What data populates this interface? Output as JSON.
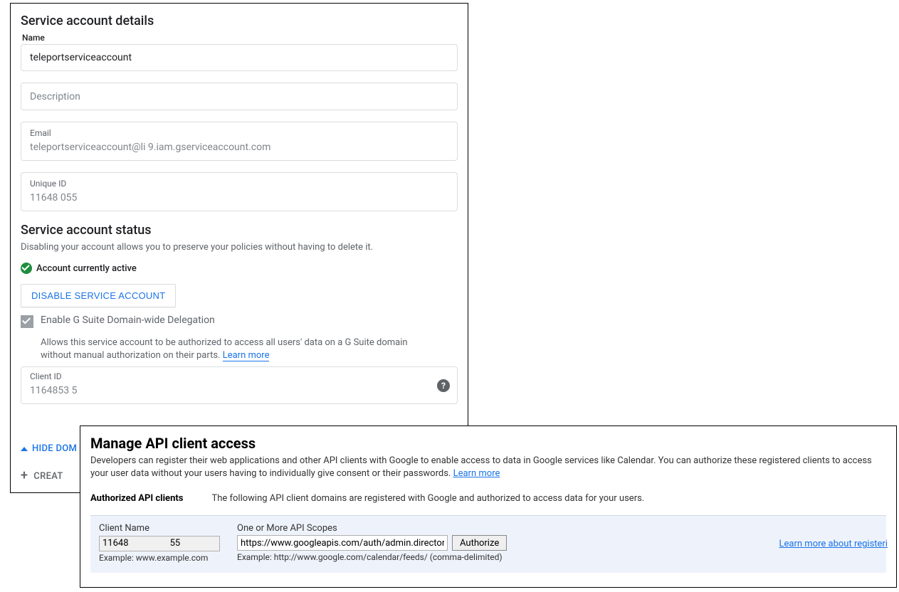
{
  "details": {
    "title": "Service account details",
    "name_label": "Name",
    "name_value": "teleportserviceaccount",
    "description_placeholder": "Description",
    "email_label": "Email",
    "email_value": "teleportserviceaccount@li                         9.iam.gserviceaccount.com",
    "unique_id_label": "Unique ID",
    "unique_id_value": "11648                    055"
  },
  "status": {
    "title": "Service account status",
    "description": "Disabling your account allows you to preserve your policies without having to delete it.",
    "active_text": "Account currently active",
    "disable_button": "DISABLE SERVICE ACCOUNT",
    "delegation_label": "Enable G Suite Domain-wide Delegation",
    "delegation_help": "Allows this service account to be authorized to access all users' data on a G Suite domain without manual authorization on their parts.",
    "learn_more": "Learn more",
    "client_id_label": "Client ID",
    "client_id_value": "1164853                    5",
    "hide_link": "HIDE DOM",
    "create_link": "CREAT"
  },
  "api": {
    "title": "Manage API client access",
    "description": "Developers can register their web applications and other API clients with Google to enable access to data in Google services like Calendar. You can authorize these registered clients to access your user data without your users having to individually give consent or their passwords.",
    "learn_more": "Learn more",
    "authorized_label": "Authorized API clients",
    "authorized_text": "The following API client domains are registered with Google and authorized to access data for your users.",
    "client_name_label": "Client Name",
    "client_name_value": "11648                  55",
    "client_name_example": "Example: www.example.com",
    "scopes_label": "One or More API Scopes",
    "scopes_value": "https://www.googleapis.com/auth/admin.directory",
    "authorize_button": "Authorize",
    "scopes_example": "Example: http://www.google.com/calendar/feeds/ (comma-delimited)",
    "learn_register": "Learn more about registeri"
  }
}
